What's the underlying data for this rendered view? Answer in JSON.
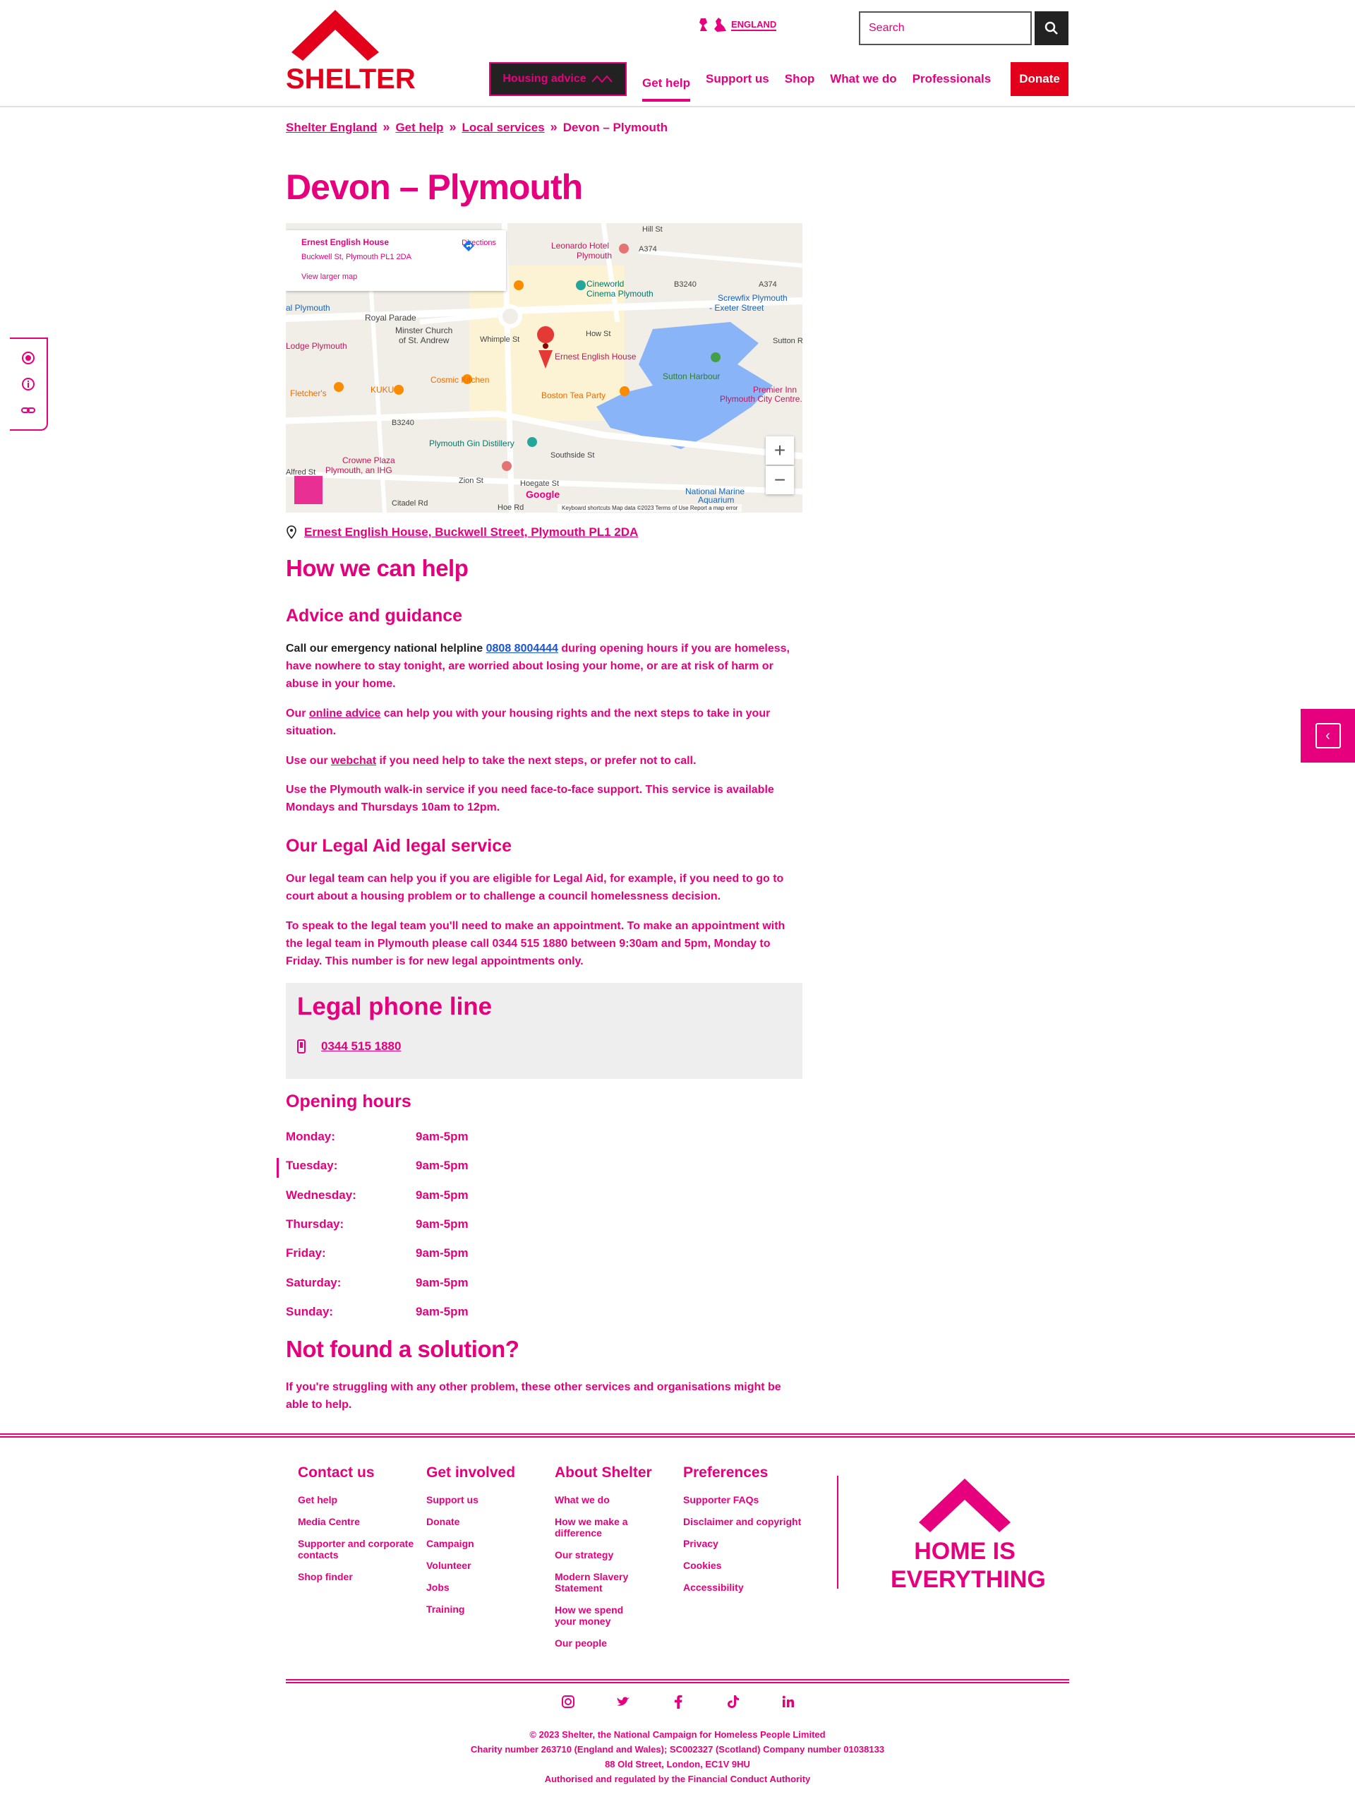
{
  "header": {
    "logo_text": "SHELTER",
    "country_label": "ENGLAND",
    "search_placeholder": "Search",
    "housing_advice_label": "Housing advice",
    "nav": [
      "Get help",
      "Support us",
      "Shop",
      "What we do",
      "Professionals"
    ],
    "donate_label": "Donate"
  },
  "breadcrumb": [
    "Shelter England",
    "Get help",
    "Local services",
    "Devon – Plymouth"
  ],
  "page_title": "Devon – Plymouth",
  "map": {
    "card_title": "Ernest English House",
    "card_address": "Buckwell St, Plymouth PL1 2DA",
    "directions_label": "Directions",
    "larger_map_label": "View larger map",
    "google_label": "Google",
    "attribution": "Keyboard shortcuts   Map data ©2023   Terms of Use   Report a map error",
    "places": [
      "Leonardo Hotel Plymouth",
      "Cineworld Cinema Plymouth",
      "Screwfix Plymouth - Exeter Street",
      "Royal Parade",
      "Minster Church of St. Andrew",
      "Ernest English House",
      "Cosmic Kitchen",
      "KUKU",
      "Fletcher's",
      "Sutton Harbour",
      "Boston Tea Party",
      "Plymouth Gin Distillery",
      "Premier Inn Plymouth City Centre",
      "Crowne Plaza Plymouth, an IHG",
      "National Marine Aquarium",
      "Lodge Plymouth",
      "al Plymouth"
    ],
    "roads": [
      "A374",
      "B3240",
      "How St",
      "Whimple St",
      "Southside St",
      "Zion St",
      "Hoegate St",
      "Citadel Rd",
      "Sutton Rd",
      "Alfred St",
      "Hill St",
      "Hoe Rd"
    ]
  },
  "address_link": "Ernest English House, Buckwell Street, Plymouth PL1 2DA",
  "how_we_help": {
    "title": "How we can help",
    "advice_title": "Advice and guidance",
    "p1_prefix": "Call our emergency national helpline ",
    "p1_phone": "0808 8004444",
    "p1_suffix": " during opening hours if you are homeless, have nowhere to stay tonight, are worried about losing your home, or are at risk of harm or abuse in your home.",
    "p2_prefix": "Our ",
    "p2_link": "online advice",
    "p2_suffix": " can help you with your housing rights and the next steps to take in your situation.",
    "p3_prefix": "Use our ",
    "p3_link": "webchat",
    "p3_suffix": " if you need help to take the next steps, or prefer not to call.",
    "p4": "Use the Plymouth walk-in service if you need face-to-face support. This service is available Mondays and Thursdays 10am to 12pm.",
    "legal_title": "Our Legal Aid legal service",
    "p5": "Our legal team can help you if you are eligible for Legal Aid, for example, if you need to go to court about a housing problem or to challenge a council homelessness decision.",
    "p6": "To speak to the legal team you'll need to make an appointment. To make an appointment with the legal team in Plymouth please call 0344 515 1880 between 9:30am and 5pm, Monday to Friday. This number is for new legal appointments only."
  },
  "legal_phone": {
    "title": "Legal phone line",
    "number": "0344 515 1880"
  },
  "opening_hours": {
    "title": "Opening hours",
    "rows": [
      {
        "day": "Monday:",
        "time": "9am-5pm"
      },
      {
        "day": "Tuesday:",
        "time": "9am-5pm"
      },
      {
        "day": "Wednesday:",
        "time": "9am-5pm"
      },
      {
        "day": "Thursday:",
        "time": "9am-5pm"
      },
      {
        "day": "Friday:",
        "time": "9am-5pm"
      },
      {
        "day": "Saturday:",
        "time": "9am-5pm"
      },
      {
        "day": "Sunday:",
        "time": "9am-5pm"
      }
    ]
  },
  "not_found": {
    "title": "Not found a solution?",
    "text": "If you're struggling with any other problem, these other services and organisations might be able to help."
  },
  "footer": {
    "columns": [
      {
        "heading": "Contact us",
        "links": [
          "Get help",
          "Media Centre",
          "Supporter and corporate contacts",
          "Shop finder"
        ]
      },
      {
        "heading": "Get involved",
        "links": [
          "Support us",
          "Donate",
          "Campaign",
          "Volunteer",
          "Jobs",
          "Training"
        ]
      },
      {
        "heading": "About Shelter",
        "links": [
          "What we do",
          "How we make a difference",
          "Our strategy",
          "Modern Slavery Statement",
          "How we spend your money",
          "Our people"
        ]
      },
      {
        "heading": "Preferences",
        "links": [
          "Supporter FAQs",
          "Disclaimer and copyright",
          "Privacy",
          "Cookies",
          "Accessibility"
        ]
      }
    ],
    "home_logo_line1": "HOME IS",
    "home_logo_line2": "EVERYTHING",
    "legal_lines": [
      "© 2023 Shelter, the National Campaign for Homeless People Limited",
      "Charity number 263710 (England and Wales); SC002327 (Scotland) Company number 01038133",
      "88 Old Street, London, EC1V 9HU",
      "Authorised and regulated by the Financial Conduct Authority"
    ]
  },
  "colors": {
    "brand": "#e2001a",
    "annotation": "#e6007e",
    "link_blue": "#1a55d8",
    "map_water": "#8ab4f8"
  }
}
